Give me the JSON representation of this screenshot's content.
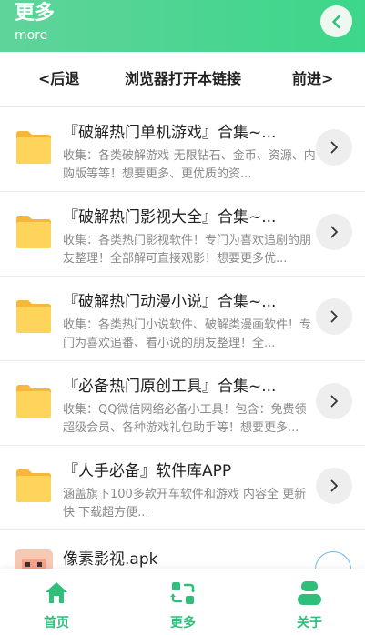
{
  "header": {
    "title": "更多",
    "subtitle": "more",
    "back_icon": "chevron-left-icon"
  },
  "navbar": {
    "back_label": "<后退",
    "open_label": "浏览器打开本链接",
    "forward_label": "前进>"
  },
  "items": [
    {
      "name": "『破解热门单机游戏』合集~...",
      "desc": "收集：各类破解游戏-无限钻石、金币、资源、内购版等等！想要更多、更优质的资..."
    },
    {
      "name": "『破解热门影视大全』合集~...",
      "desc": "收集：各类热门影视软件！专门为喜欢追剧的朋友整理！全部解可直接观影！想要更多优..."
    },
    {
      "name": "『破解热门动漫小说』合集~...",
      "desc": "收集：各类热门小说软件、破解类漫画软件！专门为喜欢追番、看小说的朋友整理！全..."
    },
    {
      "name": "『必备热门原创工具』合集~...",
      "desc": "收集：QQ微信网络必备小工具！包含：免费领超级会员、各种游戏礼包助手等！想要更多..."
    },
    {
      "name": "『人手必备』软件库APP",
      "desc": "涵盖旗下100多款开车软件和游戏 内容全 更新快 下载超方便..."
    }
  ],
  "partial_item": {
    "name": "像素影视.apk"
  },
  "tabs": [
    {
      "label": "首页",
      "icon": "home-icon"
    },
    {
      "label": "更多",
      "icon": "refresh-swap-icon"
    },
    {
      "label": "关于",
      "icon": "user-icon"
    }
  ],
  "colors": {
    "accent": "#2fbf7a",
    "header_gradient_start": "#5fd49a",
    "folder": "#ffd45a"
  }
}
